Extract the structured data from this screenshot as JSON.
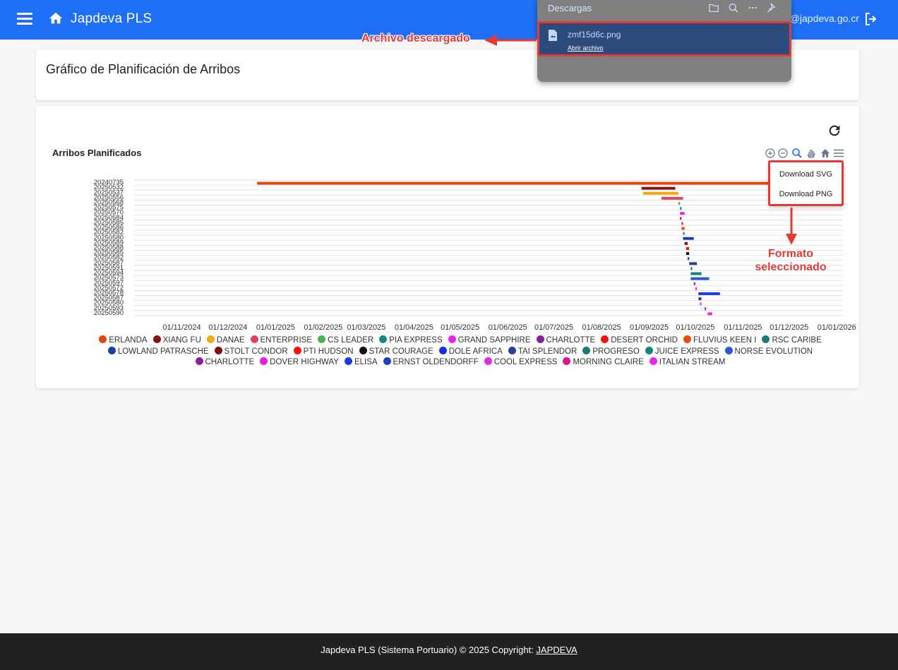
{
  "header": {
    "app_title": "Japdeva PLS",
    "user_email": "mperez@japdeva.go.cr",
    "brand_color": "#1e6ff6",
    "icons": [
      "menu-icon",
      "home-icon",
      "logout-icon"
    ]
  },
  "page": {
    "title": "Gráfico de Planificación de Arribos"
  },
  "chart_panel": {
    "refresh_icon": "refresh-icon",
    "toolbar_icons": [
      "zoom-in-icon",
      "zoom-out-icon",
      "zoom-selection-icon",
      "pan-hand-icon",
      "home-reset-icon",
      "hamburger-menu-icon"
    ],
    "download_menu": {
      "svg_label": "Download SVG",
      "png_label": "Download PNG"
    }
  },
  "chart_data": {
    "type": "rangeBar",
    "title": "Arribos Planificados",
    "x_axis": {
      "type": "datetime",
      "range": [
        "2024-10-01",
        "2026-01-05"
      ],
      "tick_labels": [
        "01/11/2024",
        "01/12/2024",
        "01/01/2025",
        "01/02/2025",
        "01/03/2025",
        "01/04/2025",
        "01/05/2025",
        "01/06/2025",
        "01/07/2025",
        "01/08/2025",
        "01/09/2025",
        "01/10/2025",
        "01/11/2025",
        "01/12/2025",
        "01/01/2026"
      ]
    },
    "categories": [
      "20240735",
      "20250532",
      "20250537",
      "20250556",
      "20250568",
      "20250575",
      "20250570",
      "20250584",
      "20250585",
      "20250586",
      "20250582",
      "20250580",
      "20250589",
      "20250588",
      "20250585",
      "20250582",
      "20250587",
      "20250591",
      "20250594",
      "20250573",
      "20250597",
      "20250572",
      "20250578",
      "20250587",
      "20250580",
      "20250593",
      "20250590"
    ],
    "series": [
      {
        "name": "ERLANDA",
        "color": "#e8440c",
        "values": [
          [
            "2024-12-20",
            "2025-12-20"
          ]
        ]
      },
      {
        "name": "XIANG FU",
        "color": "#8b1010",
        "values": [
          [
            "2025-08-27",
            "2025-09-18"
          ]
        ]
      },
      {
        "name": "DANAE",
        "color": "#f6a811",
        "values": [
          [
            "2025-08-28",
            "2025-09-20"
          ]
        ]
      },
      {
        "name": "ENTERPRISE",
        "color": "#e84260",
        "values": [
          [
            "2025-09-09",
            "2025-09-23"
          ]
        ]
      },
      {
        "name": "CS LEADER",
        "color": "#4caf50",
        "values": [
          [
            "2025-09-20",
            "2025-09-21"
          ]
        ]
      },
      {
        "name": "PIA EXPRESS",
        "color": "#138a80",
        "values": [
          [
            "2025-09-21",
            "2025-09-22"
          ]
        ]
      },
      {
        "name": "GRAND SAPPHIRE",
        "color": "#e623ee",
        "values": [
          [
            "2025-09-21",
            "2025-09-24"
          ]
        ]
      },
      {
        "name": "CHARLOTTE",
        "color": "#861fa0",
        "values": [
          [
            "2025-09-21",
            "2025-09-22"
          ]
        ]
      },
      {
        "name": "DESERT ORCHID",
        "color": "#f2110f",
        "values": [
          [
            "2025-09-22",
            "2025-09-23"
          ]
        ]
      },
      {
        "name": "FLUVIUS KEEN I",
        "color": "#f04a08",
        "values": [
          [
            "2025-09-22",
            "2025-09-24"
          ]
        ]
      },
      {
        "name": "RSC CARIBE",
        "color": "#1a7a7a",
        "values": [
          [
            "2025-09-23",
            "2025-09-24"
          ]
        ]
      },
      {
        "name": "LOWLAND PATRASCHE",
        "color": "#1f3fa8",
        "values": [
          [
            "2025-09-23",
            "2025-09-30"
          ]
        ]
      },
      {
        "name": "STOLT CONDOR",
        "color": "#800f0f",
        "values": [
          [
            "2025-09-24",
            "2025-09-26"
          ]
        ]
      },
      {
        "name": "PTI HUDSON",
        "color": "#ff0f0f",
        "values": [
          [
            "2025-09-25",
            "2025-09-27"
          ]
        ]
      },
      {
        "name": "STAR COURAGE",
        "color": "#111111",
        "values": [
          [
            "2025-09-25",
            "2025-09-27"
          ]
        ]
      },
      {
        "name": "DOLE AFRICA",
        "color": "#1530e8",
        "values": [
          [
            "2025-09-26",
            "2025-09-27"
          ]
        ]
      },
      {
        "name": "TAI SPLENDOR",
        "color": "#2a3fa0",
        "values": [
          [
            "2025-09-27",
            "2025-10-02"
          ]
        ]
      },
      {
        "name": "PROGRESO",
        "color": "#1a7a7a",
        "values": [
          [
            "2025-09-28",
            "2025-09-29"
          ]
        ]
      },
      {
        "name": "JUICE EXPRESS",
        "color": "#14847a",
        "values": [
          [
            "2025-09-28",
            "2025-10-05"
          ]
        ]
      },
      {
        "name": "NORSE EVOLUTION",
        "color": "#2a5ad0",
        "values": [
          [
            "2025-09-28",
            "2025-10-10"
          ]
        ]
      },
      {
        "name": "CHARLOTTE",
        "color": "#861fa0",
        "values": [
          [
            "2025-09-30",
            "2025-10-01"
          ]
        ]
      },
      {
        "name": "DOVER HIGHWAY",
        "color": "#ea1aea",
        "values": [
          [
            "2025-10-01",
            "2025-10-02"
          ]
        ]
      },
      {
        "name": "ELISA",
        "color": "#1a3ae8",
        "values": [
          [
            "2025-10-03",
            "2025-10-17"
          ]
        ]
      },
      {
        "name": "ERNST OLDENDORFF",
        "color": "#2040c0",
        "values": [
          [
            "2025-10-03",
            "2025-10-05"
          ]
        ]
      },
      {
        "name": "COOL EXPRESS",
        "color": "#e62ae0",
        "values": [
          [
            "2025-10-04",
            "2025-10-05"
          ]
        ]
      },
      {
        "name": "MORNING CLAIRE",
        "color": "#e0138a",
        "values": [
          [
            "2025-10-07",
            "2025-10-08"
          ]
        ]
      },
      {
        "name": "ITALIAN STREAM",
        "color": "#ee22ee",
        "values": [
          [
            "2025-10-09",
            "2025-10-12"
          ]
        ]
      }
    ],
    "legend_position": "bottom",
    "grid": true
  },
  "downloads_panel": {
    "title": "Descargas",
    "file_name": "zmf15d6c.png",
    "open_label": "Abrir archivo",
    "icons": [
      "folder-icon",
      "search-icon",
      "more-icon",
      "pin-icon",
      "file-image-icon"
    ]
  },
  "annotations": {
    "downloaded": "Archivo descargado",
    "format_line1": "Formato",
    "format_line2": "seleccionado",
    "color": "#e53935"
  },
  "footer": {
    "text": "Japdeva PLS (Sistema Portuario) © 2025 Copyright: ",
    "link": "JAPDEVA"
  }
}
